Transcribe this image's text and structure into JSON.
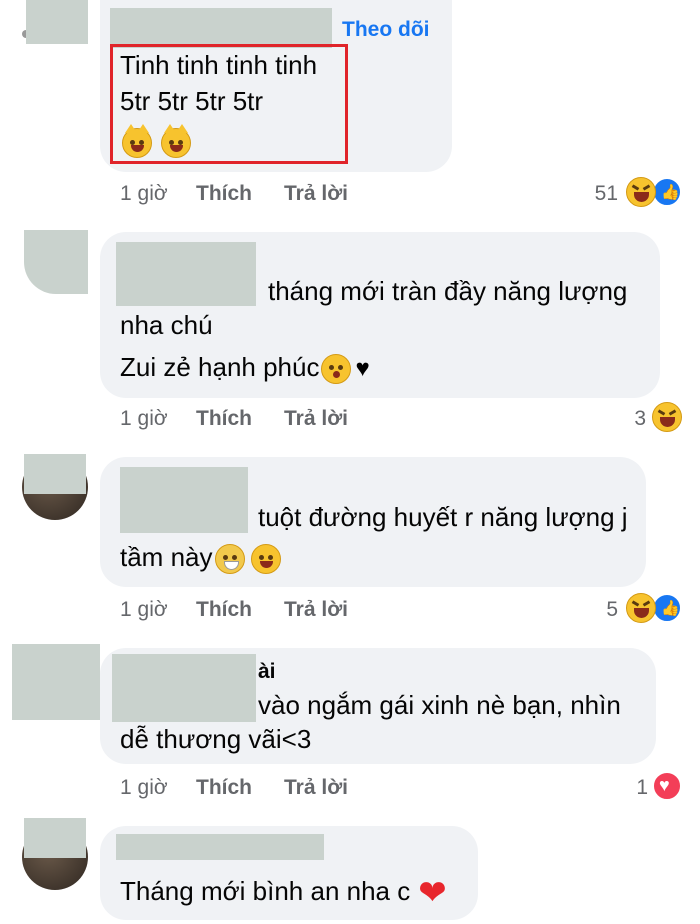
{
  "comments": [
    {
      "lines": [
        "Tinh tinh tinh tinh",
        "5tr 5tr 5tr 5tr"
      ],
      "emojis": [
        "grinning-cat-icon",
        "grinning-cat-icon"
      ],
      "follow_label": "Theo dõi",
      "time": "1 giờ",
      "like_label": "Thích",
      "reply_label": "Trả lời",
      "reaction_count": "51",
      "reactions": [
        "haha-icon",
        "like-icon"
      ]
    },
    {
      "lines": [
        "tháng mới tràn đầy năng lượng",
        "nha chú",
        "Zui zẻ hạnh phúc"
      ],
      "emojis": [
        "kissing-heart-icon",
        "black-heart-icon"
      ],
      "time": "1 giờ",
      "like_label": "Thích",
      "reply_label": "Trả lời",
      "reaction_count": "3",
      "reactions": [
        "haha-icon"
      ]
    },
    {
      "lines": [
        "tuột đường huyết r năng lượng j",
        "tầm này"
      ],
      "emojis": [
        "sneezing-face-icon",
        "grinning-squinting-icon"
      ],
      "time": "1 giờ",
      "like_label": "Thích",
      "reply_label": "Trả lời",
      "reaction_count": "5",
      "reactions": [
        "haha-icon",
        "like-icon"
      ]
    },
    {
      "name_fragment": "ài",
      "lines": [
        "vào ngắm gái xinh nè bạn, nhìn",
        "dễ thương vãi<3"
      ],
      "time": "1 giờ",
      "like_label": "Thích",
      "reply_label": "Trả lời",
      "reaction_count": "1",
      "reactions": [
        "love-icon"
      ]
    },
    {
      "lines": [
        "Tháng mới bình an nha c"
      ],
      "emojis": [
        "red-heart-icon"
      ]
    }
  ],
  "colors": {
    "bubble": "#f0f2f5",
    "link": "#1877f2",
    "meta": "#65676b",
    "highlight": "#e0242a"
  }
}
